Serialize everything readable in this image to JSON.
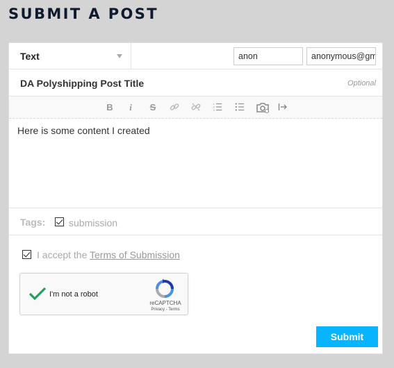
{
  "page": {
    "title": "SUBMIT A POST"
  },
  "form": {
    "post_type": {
      "selected": "Text",
      "icon": "chevron-down-icon"
    },
    "name_field": {
      "value": "anon"
    },
    "email_field": {
      "value": "anonymous@gmail.com"
    },
    "title_field": {
      "value": "DA Polyshipping Post Title",
      "hint": "Optional"
    },
    "toolbar": [
      {
        "name": "bold",
        "glyph": "B"
      },
      {
        "name": "italic",
        "glyph": "i"
      },
      {
        "name": "strikethrough",
        "glyph": "S"
      },
      {
        "name": "link",
        "glyph": "🔗"
      },
      {
        "name": "unlink",
        "glyph": "⛓"
      },
      {
        "name": "ordered-list",
        "glyph": "≡"
      },
      {
        "name": "unordered-list",
        "glyph": "≡"
      },
      {
        "name": "image",
        "glyph": "📷"
      },
      {
        "name": "indent",
        "glyph": "⇥"
      }
    ],
    "content": "Here is some content I created",
    "tags": {
      "label": "Tags:",
      "items": [
        {
          "label": "submission",
          "checked": true
        }
      ]
    },
    "accept": {
      "prefix": "I accept the ",
      "link": "Terms of Submission",
      "checked": true
    },
    "captcha": {
      "label": "I'm not a robot",
      "brand": "reCAPTCHA",
      "links": "Privacy - Terms",
      "checked": true
    },
    "submit_label": "Submit"
  },
  "colors": {
    "accent": "#09b4ff",
    "check": "#1fa35a"
  }
}
